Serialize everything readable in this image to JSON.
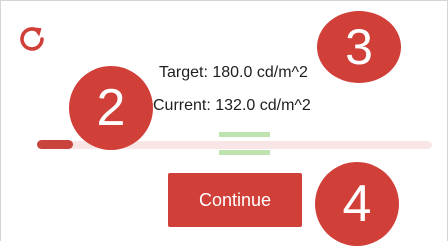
{
  "readings": {
    "target_label": "Target: 180.0 cd/m^2",
    "current_label": "Current: 132.0 cd/m^2",
    "target_value": 180.0,
    "current_value": 132.0,
    "unit": "cd/m^2"
  },
  "slider": {
    "fill_fraction": 0.09
  },
  "actions": {
    "continue_label": "Continue",
    "refresh_icon": "refresh-icon"
  },
  "annotations": {
    "step_2": "2",
    "step_3": "3",
    "step_4": "4"
  },
  "colors": {
    "accent": "#d03f38",
    "track": "#f8e6e7",
    "target_zone": "#bfe3b0"
  }
}
